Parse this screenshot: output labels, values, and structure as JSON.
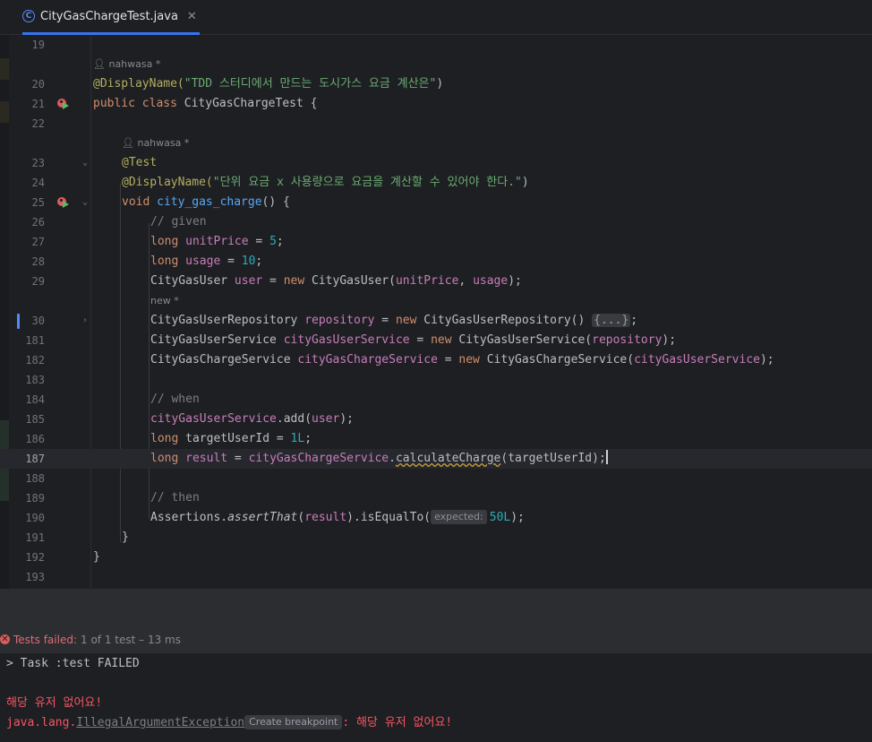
{
  "tab": {
    "title": "CityGasChargeTest.java",
    "icon": "java-class-icon"
  },
  "editor": {
    "author_hint_1": "nahwasa *",
    "author_hint_2": "nahwasa *",
    "new_hint": "new *",
    "lines": [
      {
        "n": "19"
      },
      {
        "n": "20",
        "c": "@DisplayName(\"TDD 스터디에서 만드는 도시가스 요금 계산은\")"
      },
      {
        "n": "21",
        "c": "public class CityGasChargeTest {"
      },
      {
        "n": "22"
      },
      {
        "n": "23",
        "c": "@Test"
      },
      {
        "n": "24",
        "c": "@DisplayName(\"단위 요금 x 사용량으로 요금을 계산할 수 있어야 한다.\")"
      },
      {
        "n": "25",
        "c": "void city_gas_charge() {"
      },
      {
        "n": "26",
        "c": "// given"
      },
      {
        "n": "27",
        "c": "long unitPrice = 5;"
      },
      {
        "n": "28",
        "c": "long usage = 10;"
      },
      {
        "n": "29",
        "c": "CityGasUser user = new CityGasUser(unitPrice, usage);"
      },
      {
        "n": "30",
        "c": "CityGasUserRepository repository = new CityGasUserRepository() {...};"
      },
      {
        "n": "181",
        "c": "CityGasUserService cityGasUserService = new CityGasUserService(repository);"
      },
      {
        "n": "182",
        "c": "CityGasChargeService cityGasChargeService = new CityGasChargeService(cityGasUserService);"
      },
      {
        "n": "183"
      },
      {
        "n": "184",
        "c": "// when"
      },
      {
        "n": "185",
        "c": "cityGasUserService.add(user);"
      },
      {
        "n": "186",
        "c": "long targetUserId = 1L;"
      },
      {
        "n": "187",
        "c": "long result = cityGasChargeService.calculateCharge(targetUserId);"
      },
      {
        "n": "188"
      },
      {
        "n": "189",
        "c": "// then"
      },
      {
        "n": "190",
        "c": "Assertions.assertThat(result).isEqualTo( expected: 50L);"
      },
      {
        "n": "191",
        "c": "}"
      },
      {
        "n": "192",
        "c": "}"
      },
      {
        "n": "193"
      }
    ],
    "tokens": {
      "display_name_1": "@DisplayName(",
      "display_name_1_str": "\"TDD 스터디에서 만드는 도시가스 요금 계산은\"",
      "kw_public": "public",
      "kw_class": "class",
      "class_name": " CityGasChargeTest {",
      "ann_test": "@Test",
      "display_name_2": "@DisplayName(",
      "display_name_2_str": "\"단위 요금 x 사용량으로 요금을 계산할 수 있어야 한다.\"",
      "kw_void": "void",
      "method_name": "city_gas_charge",
      "comment_given": "// given",
      "comment_when": "// when",
      "comment_then": "// then",
      "kw_long": "long",
      "var_unitPrice": "unitPrice",
      "num_5": "5",
      "var_usage": "usage",
      "num_10": "10",
      "type_user": "CityGasUser",
      "var_user": "user",
      "kw_new": "new",
      "type_repo": "CityGasUserRepository",
      "var_repo": "repository",
      "fold_placeholder": "{...}",
      "type_userService": "CityGasUserService",
      "var_userService": "cityGasUserService",
      "type_chargeService": "CityGasChargeService",
      "var_chargeService": "cityGasChargeService",
      "method_add": ".add(",
      "var_targetUserId": "targetUserId",
      "num_1L": "1L",
      "var_result": "result",
      "method_calc": "calculateCharge",
      "assertions": "Assertions.",
      "assertThat": "assertThat",
      "isEqualTo": ").isEqualTo(",
      "inlay_expected": "expected:",
      "num_50L": "50L"
    }
  },
  "run_panel": {
    "status_fail": "Tests failed:",
    "status_rest": "1 of 1 test – 13 ms",
    "console": {
      "task": "> Task :test FAILED",
      "error_msg": "해당 유저 없어요!",
      "exception_prefix": "java.lang.",
      "exception_class": "IllegalArgumentException",
      "create_breakpoint": "Create breakpoint",
      "exception_suffix": ": 해당 유저 없어요!"
    }
  },
  "colors": {
    "accent": "#3574f0",
    "error": "#db5c5c",
    "keyword": "#cf8e6d",
    "string": "#6aab73",
    "number": "#2aacb8",
    "annotation": "#b3ae60",
    "variable": "#c77dbb",
    "function": "#56a8f5"
  }
}
